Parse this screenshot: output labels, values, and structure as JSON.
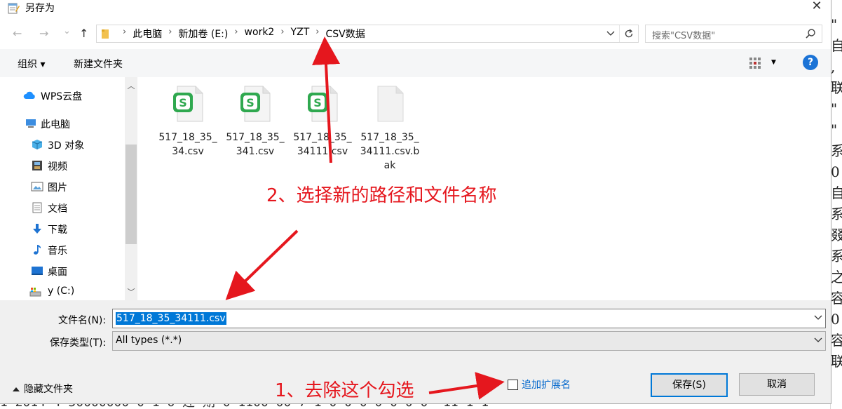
{
  "window": {
    "title": "另存为",
    "close_glyph": "✕"
  },
  "nav": {
    "back_glyph": "←",
    "forward_glyph": "→",
    "history_glyph": "⌄",
    "up_glyph": "↑",
    "breadcrumbs": [
      "此电脑",
      "新加卷 (E:)",
      "work2",
      "YZT",
      "CSV数据"
    ],
    "crumb_separator": "›"
  },
  "search": {
    "placeholder": "搜索\"CSV数据\""
  },
  "toolbar": {
    "organize_label": "组织 ▾",
    "new_folder_label": "新建文件夹",
    "help_glyph": "?"
  },
  "sidebar": {
    "items": [
      {
        "label": "WPS云盘",
        "icon": "cloud-icon"
      },
      {
        "label": "此电脑",
        "icon": "computer-icon"
      },
      {
        "label": "3D 对象",
        "icon": "cube-icon"
      },
      {
        "label": "视频",
        "icon": "film-icon"
      },
      {
        "label": "图片",
        "icon": "picture-icon"
      },
      {
        "label": "文档",
        "icon": "document-icon"
      },
      {
        "label": "下载",
        "icon": "download-icon"
      },
      {
        "label": "音乐",
        "icon": "music-icon"
      },
      {
        "label": "桌面",
        "icon": "desktop-icon"
      },
      {
        "label": "y (C:)",
        "icon": "drive-icon"
      }
    ]
  },
  "files": [
    {
      "name": "517_18_35_34.csv",
      "icon": "wps-spreadsheet-icon"
    },
    {
      "name": "517_18_35_341.csv",
      "icon": "wps-spreadsheet-icon"
    },
    {
      "name": "517_18_35_34111.csv",
      "icon": "wps-spreadsheet-icon"
    },
    {
      "name": "517_18_35_34111.csv.bak",
      "icon": "blank-file-icon"
    }
  ],
  "form": {
    "filename_label": "文件名(N):",
    "filename_value": "517_18_35_34111.csv",
    "filetype_label": "保存类型(T):",
    "filetype_value": "All types (*.*)",
    "hide_folders_label": "隐藏文件夹",
    "append_ext_label": "追加扩展名",
    "append_ext_checked": false,
    "save_label": "保存(S)",
    "cancel_label": "取消"
  },
  "annotations": {
    "step1": "1、去除这个勾选",
    "step2": "2、选择新的路径和文件名称",
    "color": "#e5171e"
  },
  "background": {
    "right_edge_chars": "\"\n自\n,\n联\n\"\n\"\n系\n0\n自\n系\n叕\n系\n之\n容\n0\n容\n联",
    "bottom_edge_text": "1 2014 4 50000000 0 1 6 迎 期 0 1100 00 7 1 0 0 0 0 0 0 0 \"11 1 1"
  },
  "colors": {
    "accent": "#0078d7",
    "annotation": "#e5171e",
    "wps_green": "#2fa84f"
  }
}
